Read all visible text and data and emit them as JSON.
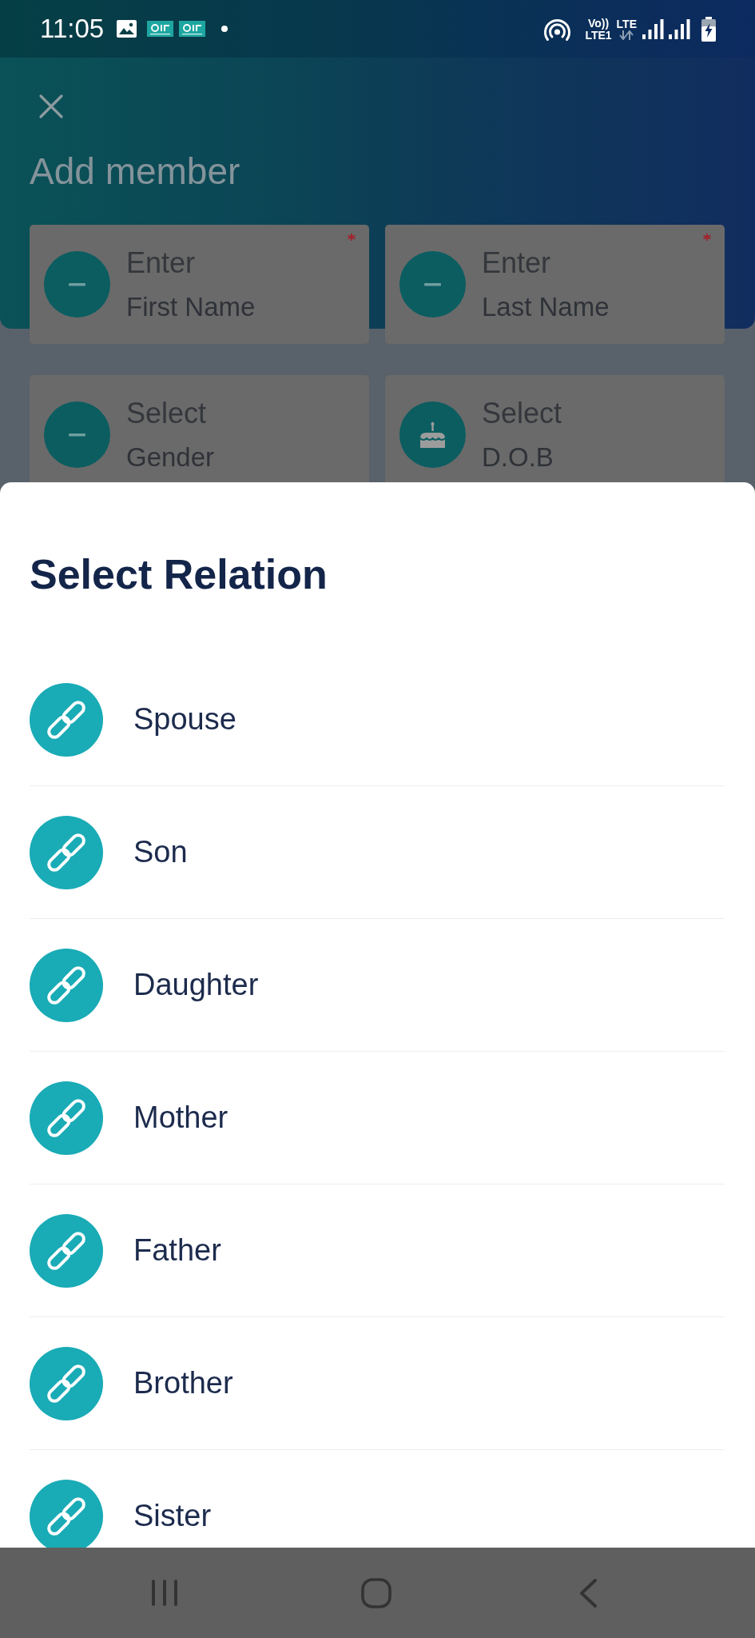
{
  "status_bar": {
    "time": "11:05",
    "volte": "Vo))",
    "volte_band": "LTE1",
    "network": "LTE"
  },
  "header": {
    "title": "Add member"
  },
  "form_fields": [
    {
      "kind": "name",
      "prompt": "Enter",
      "label": "First Name",
      "required": true
    },
    {
      "kind": "name",
      "prompt": "Enter",
      "label": "Last Name",
      "required": true
    },
    {
      "kind": "choice",
      "prompt": "Select",
      "label": "Gender",
      "required": false
    },
    {
      "kind": "date",
      "prompt": "Select",
      "label": "D.O.B",
      "required": false
    }
  ],
  "relation_sheet": {
    "title": "Select Relation",
    "options": [
      {
        "label": "Spouse",
        "selected": false
      },
      {
        "label": "Son",
        "selected": false
      },
      {
        "label": "Daughter",
        "selected": false
      },
      {
        "label": "Mother",
        "selected": false
      },
      {
        "label": "Father",
        "selected": false
      },
      {
        "label": "Brother",
        "selected": false
      },
      {
        "label": "Sister",
        "selected": false
      }
    ]
  }
}
